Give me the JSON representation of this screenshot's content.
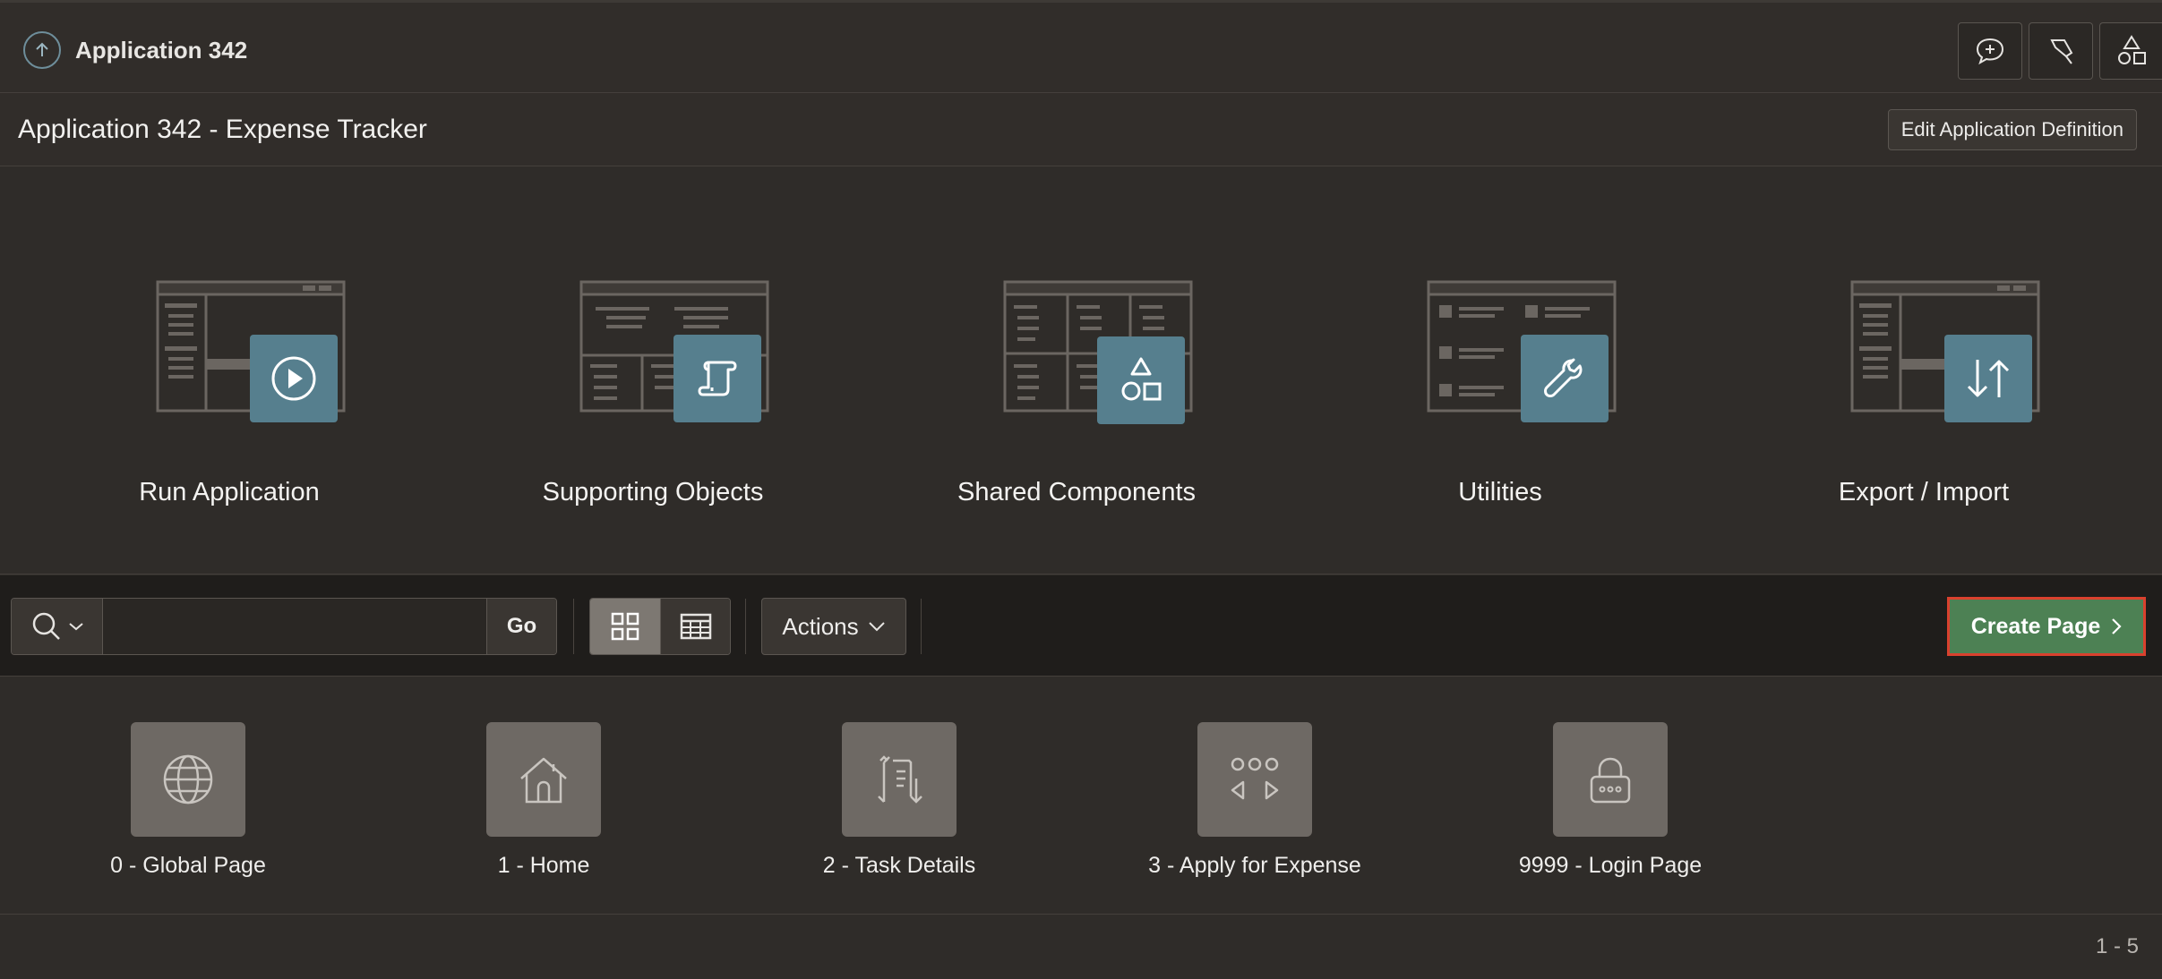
{
  "header": {
    "breadcrumb": "Application 342",
    "tools": [
      {
        "icon": "chat-plus-icon"
      },
      {
        "icon": "pin-icon"
      },
      {
        "icon": "shapes-icon"
      }
    ]
  },
  "title": {
    "text": "Application 342 - Expense Tracker",
    "edit_button": "Edit Application Definition"
  },
  "tiles": [
    {
      "label": "Run Application",
      "icon": "play-icon"
    },
    {
      "label": "Supporting Objects",
      "icon": "scroll-icon"
    },
    {
      "label": "Shared Components",
      "icon": "shapes-icon"
    },
    {
      "label": "Utilities",
      "icon": "wrench-icon"
    },
    {
      "label": "Export / Import",
      "icon": "arrows-up-down-icon"
    }
  ],
  "toolbar": {
    "search_value": "",
    "go_label": "Go",
    "actions_label": "Actions",
    "create_label": "Create Page"
  },
  "pages": [
    {
      "label": "0 - Global Page",
      "icon": "globe-icon"
    },
    {
      "label": "1 - Home",
      "icon": "home-icon"
    },
    {
      "label": "2 - Task Details",
      "icon": "details-icon"
    },
    {
      "label": "3 - Apply for Expense",
      "icon": "wizard-icon"
    },
    {
      "label": "9999 - Login Page",
      "icon": "lock-icon"
    }
  ],
  "pagination": "1 - 5",
  "colors": {
    "accent_teal": "#567f8e",
    "create_green": "#4d8154",
    "highlight_red": "#d9412e"
  }
}
